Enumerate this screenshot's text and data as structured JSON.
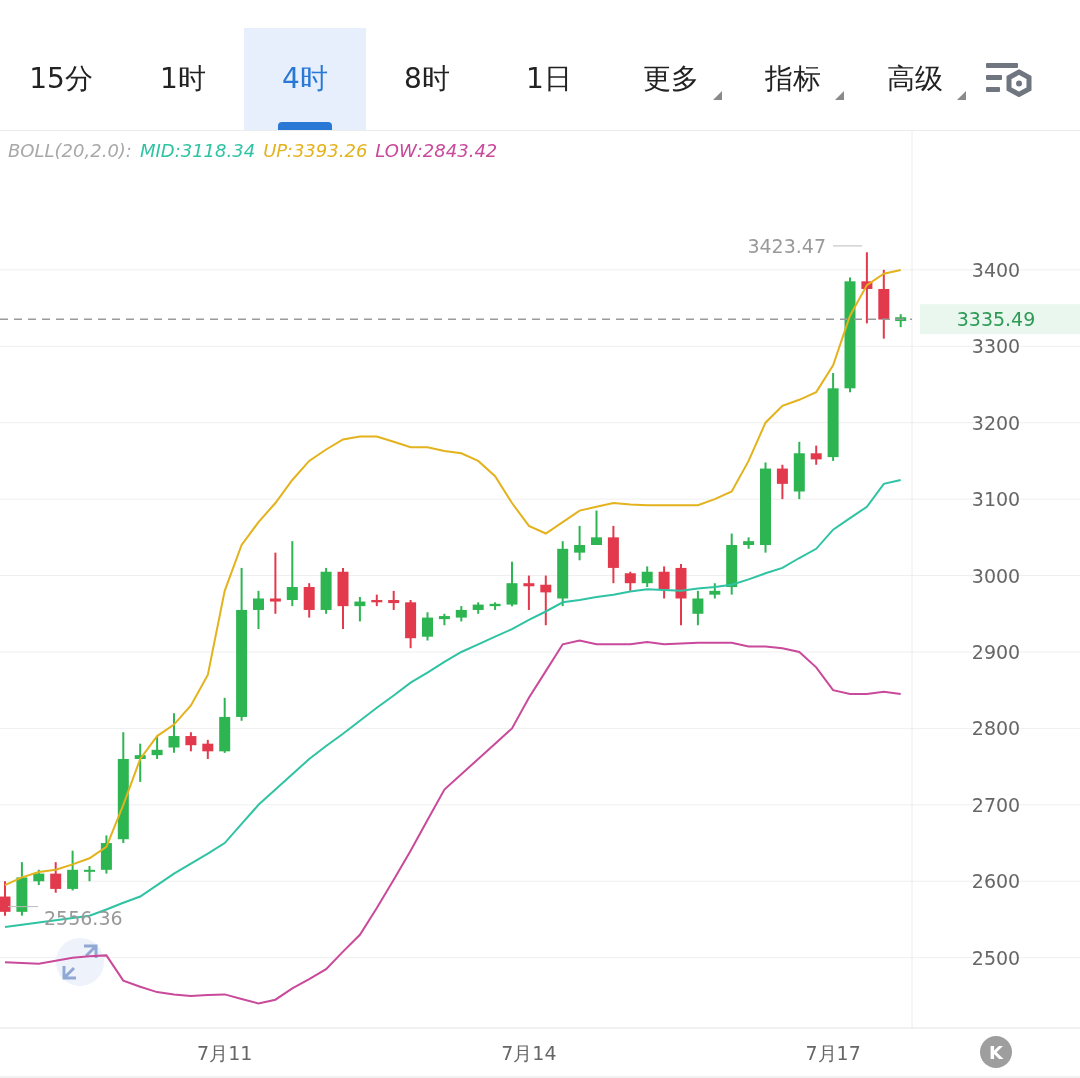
{
  "tabs": [
    {
      "label": "15分",
      "kind": "period",
      "selected": false
    },
    {
      "label": "1时",
      "kind": "period",
      "selected": false
    },
    {
      "label": "4时",
      "kind": "period",
      "selected": true
    },
    {
      "label": "8时",
      "kind": "period",
      "selected": false
    },
    {
      "label": "1日",
      "kind": "period",
      "selected": false
    },
    {
      "label": "更多",
      "kind": "dropdown",
      "selected": false
    },
    {
      "label": "指标",
      "kind": "dropdown",
      "selected": false
    },
    {
      "label": "高级",
      "kind": "dropdown",
      "selected": false
    }
  ],
  "legend": [
    {
      "text": "BOLL(20,2.0):",
      "color": "#a8a8a8"
    },
    {
      "text": "MID:3118.34",
      "color": "#2fc3a3"
    },
    {
      "text": "UP:3393.26",
      "color": "#e3b21c"
    },
    {
      "text": "LOW:2843.42",
      "color": "#c9499a"
    }
  ],
  "high_label": "3423.47",
  "low_label": "2556.36",
  "last_price": "3335.49",
  "kline_button": "K",
  "chart_data": {
    "type": "candlestick",
    "grid": true,
    "ref_lines": [
      {
        "axis": "y",
        "value": 3335.49
      }
    ],
    "ylim": [
      2408,
      3583
    ],
    "yticks": [
      2500,
      2600,
      2700,
      2800,
      2900,
      3000,
      3100,
      3200,
      3300,
      3400
    ],
    "categories": [
      null,
      null,
      null,
      null,
      null,
      null,
      null,
      null,
      null,
      null,
      null,
      null,
      null,
      "7月11",
      null,
      null,
      null,
      null,
      null,
      null,
      null,
      null,
      null,
      null,
      null,
      null,
      null,
      null,
      null,
      null,
      null,
      "7月14",
      null,
      null,
      null,
      null,
      null,
      null,
      null,
      null,
      null,
      null,
      null,
      null,
      null,
      null,
      null,
      null,
      null,
      "7月17",
      null,
      null,
      null,
      null
    ],
    "ohlc": [
      [
        2580,
        2600,
        2555,
        2560
      ],
      [
        2560,
        2625,
        2555,
        2605
      ],
      [
        2600,
        2615,
        2595,
        2610
      ],
      [
        2610,
        2625,
        2585,
        2590
      ],
      [
        2590,
        2640,
        2588,
        2615
      ],
      [
        2613,
        2620,
        2600,
        2615
      ],
      [
        2615,
        2660,
        2610,
        2650
      ],
      [
        2655,
        2795,
        2650,
        2760
      ],
      [
        2760,
        2780,
        2730,
        2765
      ],
      [
        2765,
        2790,
        2760,
        2772
      ],
      [
        2775,
        2820,
        2768,
        2790
      ],
      [
        2790,
        2795,
        2770,
        2778
      ],
      [
        2780,
        2785,
        2760,
        2770
      ],
      [
        2770,
        2840,
        2768,
        2815
      ],
      [
        2815,
        3010,
        2810,
        2955
      ],
      [
        2955,
        2980,
        2930,
        2970
      ],
      [
        2970,
        3030,
        2950,
        2966
      ],
      [
        2968,
        3045,
        2960,
        2985
      ],
      [
        2985,
        2990,
        2945,
        2955
      ],
      [
        2955,
        3010,
        2950,
        3005
      ],
      [
        3005,
        3010,
        2930,
        2960
      ],
      [
        2960,
        2972,
        2940,
        2966
      ],
      [
        2968,
        2975,
        2960,
        2965
      ],
      [
        2968,
        2980,
        2955,
        2964
      ],
      [
        2965,
        2968,
        2905,
        2918
      ],
      [
        2920,
        2952,
        2915,
        2945
      ],
      [
        2943,
        2950,
        2935,
        2947
      ],
      [
        2945,
        2960,
        2940,
        2955
      ],
      [
        2955,
        2965,
        2950,
        2962
      ],
      [
        2960,
        2965,
        2955,
        2963
      ],
      [
        2962,
        3018,
        2960,
        2990
      ],
      [
        2990,
        3000,
        2955,
        2986
      ],
      [
        2988,
        3000,
        2935,
        2978
      ],
      [
        2970,
        3045,
        2960,
        3035
      ],
      [
        3030,
        3065,
        3020,
        3040
      ],
      [
        3040,
        3085,
        3040,
        3050
      ],
      [
        3050,
        3065,
        2990,
        3010
      ],
      [
        3003,
        3005,
        2980,
        2990
      ],
      [
        2990,
        3012,
        2985,
        3005
      ],
      [
        3005,
        3012,
        2970,
        2982
      ],
      [
        3010,
        3015,
        2935,
        2970
      ],
      [
        2950,
        2980,
        2935,
        2970
      ],
      [
        2975,
        2990,
        2970,
        2980
      ],
      [
        2985,
        3055,
        2975,
        3040
      ],
      [
        3040,
        3050,
        3035,
        3045
      ],
      [
        3040,
        3148,
        3030,
        3140
      ],
      [
        3140,
        3145,
        3100,
        3120
      ],
      [
        3110,
        3175,
        3100,
        3160
      ],
      [
        3160,
        3170,
        3145,
        3152
      ],
      [
        3155,
        3265,
        3150,
        3245
      ],
      [
        3245,
        3390,
        3240,
        3385
      ],
      [
        3385,
        3423,
        3330,
        3375
      ],
      [
        3375,
        3400,
        3310,
        3335
      ],
      [
        3333,
        3342,
        3325,
        3338
      ]
    ],
    "series": [
      {
        "type": "line",
        "color": "#e3b21c",
        "values": [
          2595,
          2605,
          2612,
          2615,
          2622,
          2630,
          2645,
          2700,
          2760,
          2790,
          2805,
          2830,
          2870,
          2980,
          3040,
          3070,
          3095,
          3125,
          3150,
          3165,
          3178,
          3182,
          3182,
          3175,
          3168,
          3168,
          3163,
          3160,
          3150,
          3130,
          3095,
          3065,
          3055,
          3070,
          3085,
          3090,
          3095,
          3093,
          3092,
          3092,
          3092,
          3092,
          3100,
          3110,
          3150,
          3200,
          3222,
          3230,
          3240,
          3275,
          3340,
          3380,
          3395,
          3400
        ]
      },
      {
        "type": "line",
        "color": "#2fc3a3",
        "values": [
          2540,
          2543,
          2546,
          2549,
          2552,
          2555,
          2563,
          2572,
          2580,
          2595,
          2610,
          2623,
          2636,
          2650,
          2675,
          2700,
          2720,
          2740,
          2760,
          2777,
          2793,
          2810,
          2827,
          2843,
          2860,
          2873,
          2887,
          2900,
          2910,
          2920,
          2930,
          2942,
          2953,
          2965,
          2968,
          2972,
          2975,
          2979,
          2982,
          2981,
          2980,
          2983,
          2985,
          2988,
          2995,
          3003,
          3010,
          3023,
          3035,
          3060,
          3075,
          3090,
          3120,
          3125
        ]
      },
      {
        "type": "line",
        "color": "#c9499a",
        "values": [
          2494,
          2493,
          2492,
          2496,
          2500,
          2502,
          2503,
          2470,
          2462,
          2455,
          2452,
          2450,
          2451,
          2452,
          2446,
          2440,
          2445,
          2460,
          2472,
          2485,
          2508,
          2530,
          2565,
          2602,
          2640,
          2680,
          2720,
          2740,
          2760,
          2780,
          2800,
          2840,
          2875,
          2910,
          2915,
          2910,
          2910,
          2910,
          2913,
          2910,
          2911,
          2912,
          2912,
          2912,
          2907,
          2907,
          2905,
          2900,
          2880,
          2850,
          2845,
          2845,
          2848,
          2845
        ]
      }
    ]
  }
}
